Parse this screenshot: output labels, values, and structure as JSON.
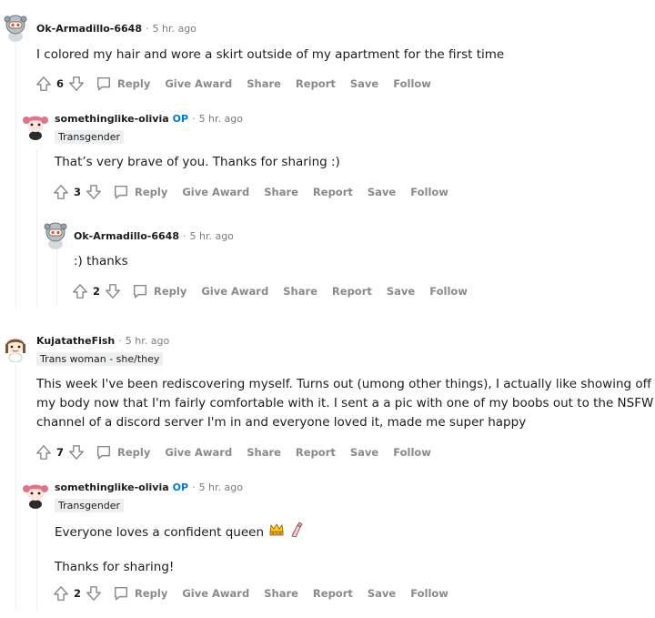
{
  "labels": {
    "reply": "Reply",
    "give_award": "Give Award",
    "share": "Share",
    "report": "Report",
    "save": "Save",
    "follow": "Follow",
    "op": "OP",
    "separator": "·"
  },
  "comments": [
    {
      "author": "Ok-Armadillo-6648",
      "time": "5 hr. ago",
      "avatar": "snoo-avatar-helmet-gray",
      "body": [
        "I colored my hair and wore a skirt outside of my apartment for the first time"
      ],
      "score": "6"
    },
    {
      "author": "somethinglike-olivia",
      "is_op": true,
      "time": "5 hr. ago",
      "flair": "Transgender",
      "avatar": "snoo-avatar-pink-hair",
      "body": [
        "That’s very brave of you. Thanks for sharing :)"
      ],
      "score": "3"
    },
    {
      "author": "Ok-Armadillo-6648",
      "time": "5 hr. ago",
      "avatar": "snoo-avatar-helmet-gray",
      "body": [
        ":) thanks"
      ],
      "score": "2"
    },
    {
      "author": "KujatatheFish",
      "time": "5 hr. ago",
      "flair": "Trans woman - she/they",
      "avatar": "snoo-avatar-brown-hair",
      "body": [
        "This week I've been rediscovering myself. Turns out (umong other things), I actually like showing off",
        "my body now that I'm fairly comfortable with it. I sent a a pic with one of my boobs out to the NSFW",
        "channel of a discord server I'm in and everyone loved it, made me super happy"
      ],
      "score": "7"
    },
    {
      "author": "somethinglike-olivia",
      "is_op": true,
      "time": "5 hr. ago",
      "flair": "Transgender",
      "avatar": "snoo-avatar-pink-hair",
      "body": [
        "Everyone loves a confident queen",
        "Thanks for sharing!"
      ],
      "emojis": [
        "crown-emoji",
        "nail-polish-emoji"
      ],
      "score": "2"
    }
  ],
  "colors": {
    "op_blue": "#0079d3",
    "meta_gray": "#787c7e",
    "action_gray": "#878a8c",
    "flair_bg": "#edeff1",
    "thread_line": "#edeff1"
  }
}
